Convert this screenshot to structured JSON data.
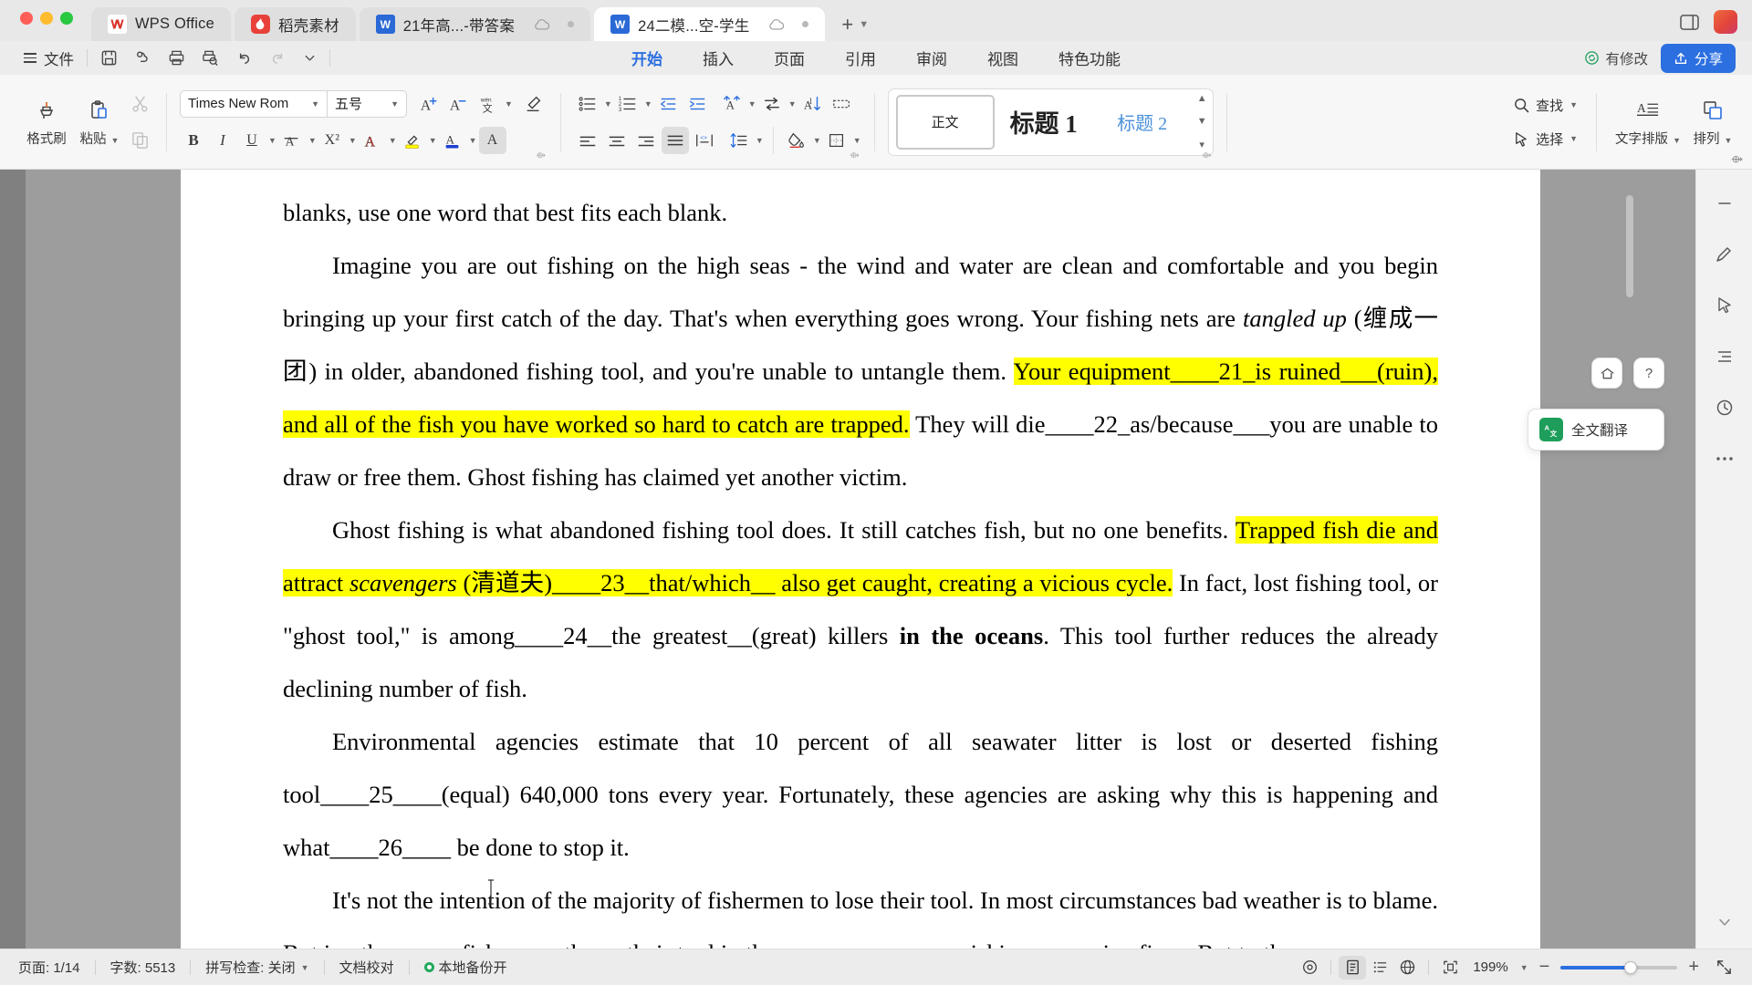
{
  "window": {
    "tabs": [
      {
        "icon": "wps-logo-icon",
        "label": "WPS Office",
        "active": false,
        "cloud": false,
        "dot": false
      },
      {
        "icon": "daoke-icon",
        "label": "稻壳素材",
        "active": false,
        "cloud": false,
        "dot": false
      },
      {
        "icon": "word-doc-icon",
        "label": "21年高...-带答案",
        "active": false,
        "cloud": true,
        "dot": true
      },
      {
        "icon": "word-doc-icon",
        "label": "24二模...空-学生",
        "active": true,
        "cloud": true,
        "dot": true
      }
    ],
    "new_tab_label": "+"
  },
  "menubar": {
    "file_label": "文件",
    "quick_icons": [
      "save-icon",
      "cloud-sync-icon",
      "print-icon",
      "print-preview-icon",
      "undo-icon",
      "redo-icon",
      "customize-chevron-icon"
    ],
    "ribbon_tabs": [
      {
        "label": "开始",
        "active": true
      },
      {
        "label": "插入",
        "active": false
      },
      {
        "label": "页面",
        "active": false
      },
      {
        "label": "引用",
        "active": false
      },
      {
        "label": "审阅",
        "active": false
      },
      {
        "label": "视图",
        "active": false
      },
      {
        "label": "特色功能",
        "active": false
      }
    ],
    "modified_label": "有修改",
    "share_label": "分享"
  },
  "ribbon": {
    "format_painter_label": "格式刷",
    "paste_label": "粘贴",
    "copy_icon": "copy-icon",
    "cut_icon": "cut-icon",
    "font_name": "Times New Rom",
    "font_size": "五号",
    "font_tools": [
      "grow-font-icon",
      "shrink-font-icon",
      "pinyin-guide-icon",
      "clear-format-icon"
    ],
    "font_tools_row2": [
      "bold-icon",
      "italic-icon",
      "underline-icon",
      "strikethrough-icon",
      "superscript-icon",
      "text-effects-icon",
      "highlight-icon",
      "font-color-icon",
      "character-shading-icon"
    ],
    "bold_label": "B",
    "italic_label": "I",
    "underline_label": "U",
    "superscript_label": "X²",
    "para_tools": [
      "bullet-list-icon",
      "numbered-list-icon",
      "decrease-indent-icon",
      "increase-indent-icon",
      "asian-layout-icon",
      "text-direction-icon",
      "sort-icon",
      "show-marks-icon"
    ],
    "align_tools": [
      "align-left-icon",
      "align-center-icon",
      "align-right-icon",
      "justify-icon",
      "distribute-icon",
      "line-spacing-icon",
      "shading-icon",
      "borders-icon"
    ],
    "styles": [
      {
        "label": "正文",
        "selected": true,
        "kind": "body"
      },
      {
        "label": "标题 1",
        "selected": false,
        "kind": "h1"
      },
      {
        "label": "标题 2",
        "selected": false,
        "kind": "h2"
      }
    ],
    "find_label": "查找",
    "select_label": "选择",
    "text_layout_label": "文字排版",
    "arrange_label": "排列"
  },
  "right_rail": {
    "items": [
      "reading-layout-icon",
      "pen-annotate-icon",
      "select-cursor-icon",
      "outline-icon",
      "history-icon",
      "more-icon"
    ],
    "translate_label": "全文翻译",
    "translate_icon": "translate-icon",
    "home_icon": "home-icon",
    "help_icon": "help-icon"
  },
  "document": {
    "paragraphs": [
      {
        "indent": false,
        "runs": [
          {
            "text": "blanks, use one word that best fits each blank.",
            "style": "plain"
          }
        ]
      },
      {
        "indent": true,
        "runs": [
          {
            "text": "Imagine you are out fishing on the high seas - the wind and water are clean and comfortable and you begin bringing up your first catch of the day. That's when everything goes wrong. Your fishing nets are ",
            "style": "plain"
          },
          {
            "text": "tangled up",
            "style": "italic"
          },
          {
            "text": " (缠成一团) in older, abandoned fishing tool, and you're unable to untangle them. ",
            "style": "plain"
          },
          {
            "text": "Your equipment____21_is ruined___(ruin), and all of the fish you have worked so hard to catch are trapped.",
            "style": "highlight"
          },
          {
            "text": " They will die____22_as/because___you are unable to draw or free them. Ghost fishing has claimed yet another victim.",
            "style": "plain"
          }
        ]
      },
      {
        "indent": true,
        "runs": [
          {
            "text": "Ghost fishing is what abandoned fishing tool does. It still catches fish, but no one benefits. ",
            "style": "plain"
          },
          {
            "text": "Trapped fish die and attract ",
            "style": "highlight"
          },
          {
            "text": "scavengers",
            "style": "highlight-italic"
          },
          {
            "text": " (清道夫)____23__that/which__ also get caught, creating a vicious cycle.",
            "style": "highlight"
          },
          {
            "text": " In fact, lost fishing tool, or \"ghost tool,\" is among____24__the greatest__(great) killers ",
            "style": "plain"
          },
          {
            "text": "in the oceans",
            "style": "bold"
          },
          {
            "text": ". This tool further reduces the already declining number of fish.",
            "style": "plain"
          }
        ]
      },
      {
        "indent": true,
        "runs": [
          {
            "text": "Environmental agencies estimate that 10 percent of all seawater litter is lost or deserted fishing tool____25____(equal) 640,000 tons every year. Fortunately, these agencies are asking why this is happening and what____26____ be done to stop it.",
            "style": "plain"
          }
        ]
      },
      {
        "indent": true,
        "runs": [
          {
            "text": "It's not the intention of the majority of fishermen to lose their tool. In most circumstances bad weather is to blame. But in other cases fishermen throw their tool in the ocean on purpose, risking expensive fines. But to them,",
            "style": "plain"
          }
        ]
      }
    ]
  },
  "statusbar": {
    "page_label": "页面: 1/14",
    "words_label": "字数: 5513",
    "spellcheck_label": "拼写检查: 关闭",
    "proofread_label": "文档校对",
    "backup_label": "本地备份开",
    "view_icons": [
      "eye-icon",
      "page-view-icon",
      "outline-view-icon",
      "web-view-icon",
      "fit-page-icon"
    ],
    "zoom_label": "199%",
    "zoom_out_label": "−",
    "zoom_in_label": "+",
    "fullscreen_icon": "fullscreen-icon"
  },
  "colors": {
    "accent": "#2B6FE0",
    "highlight": "#FFFF00",
    "titlebar": "#E8E8E8",
    "ribbon": "#F7F7F7",
    "workspace": "#9D9D9D",
    "green": "#22A85B"
  }
}
